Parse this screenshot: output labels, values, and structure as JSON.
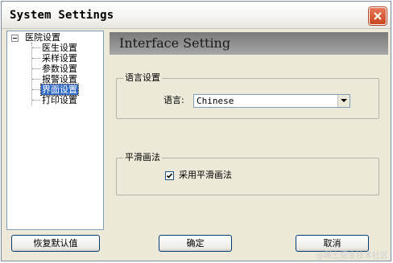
{
  "window": {
    "title": "System Settings"
  },
  "tree": {
    "root": "医院设置",
    "items": [
      {
        "label": "医生设置"
      },
      {
        "label": "采样设置"
      },
      {
        "label": "参数设置"
      },
      {
        "label": "报警设置"
      },
      {
        "label": "界面设置",
        "selected": true
      },
      {
        "label": "打印设置"
      }
    ]
  },
  "panel": {
    "header": "Interface Setting",
    "language_group": {
      "legend": "语言设置",
      "label": "语言:",
      "selected_value": "Chinese"
    },
    "smoothing_group": {
      "legend": "平滑画法",
      "checkbox_label": "采用平滑画法",
      "checked": true
    }
  },
  "buttons": {
    "restore_defaults": "恢复默认值",
    "ok": "确定",
    "cancel": "取消"
  },
  "watermark": "@稀土掘金技术社区",
  "colors": {
    "selection": "#316ac5",
    "close_button": "#d8583a",
    "header_band": "#8f8f8f",
    "window_bg": "#ece9d8"
  }
}
